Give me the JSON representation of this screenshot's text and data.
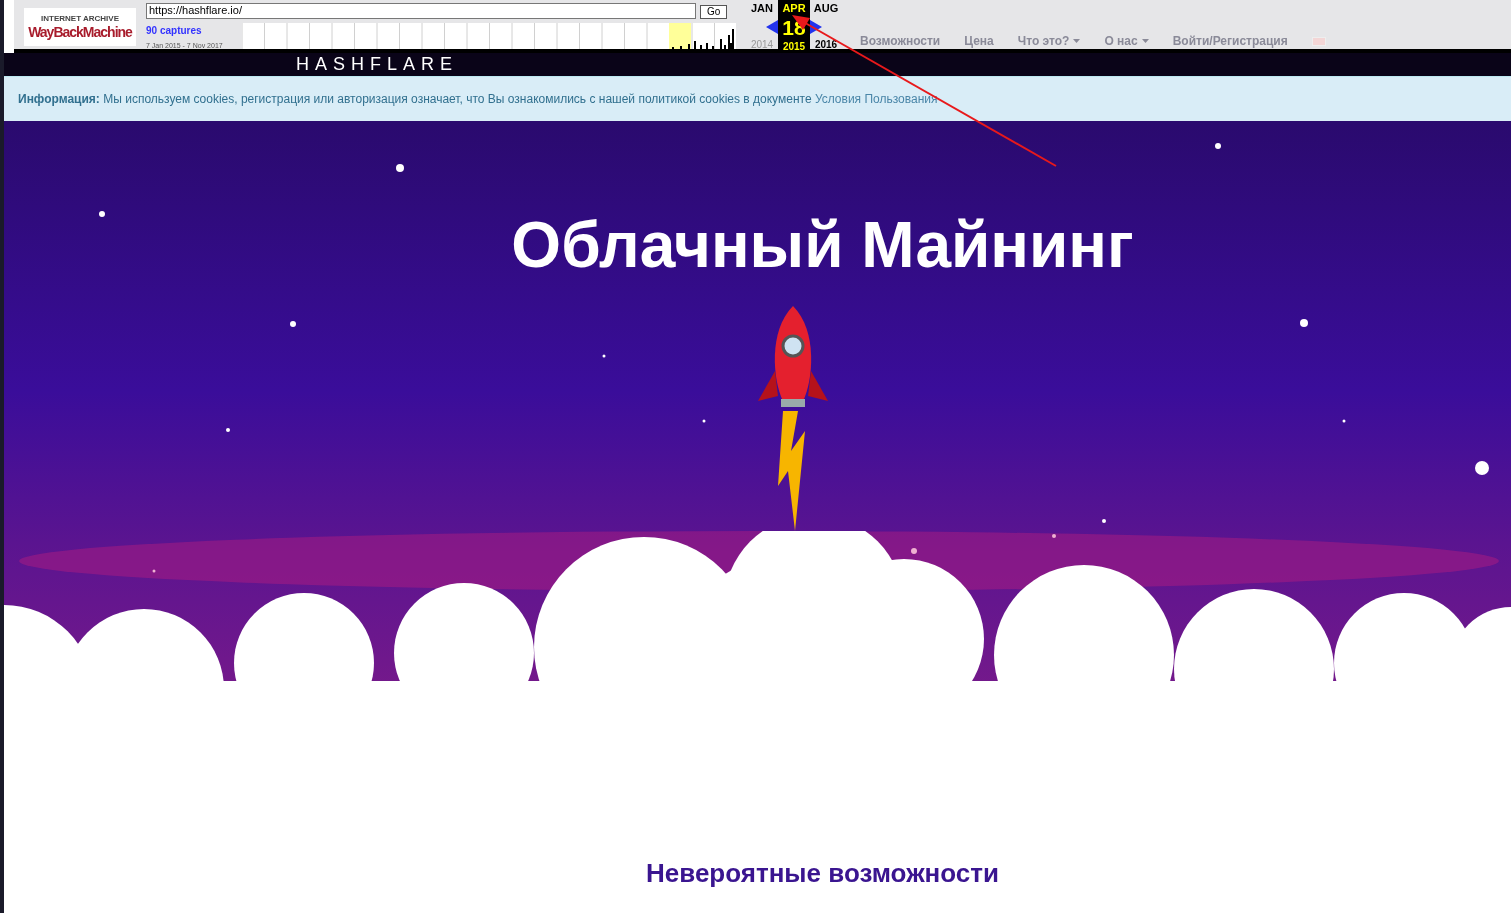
{
  "wayback": {
    "logo_top": "INTERNET ARCHIVE",
    "logo_main": "WayBackMachine",
    "url": "https://hashflare.io/",
    "go_button": "Go",
    "captures": "90 captures",
    "range": "7 Jan 2015 - 7 Nov 2017",
    "months": [
      {
        "label": "JAN",
        "selected": false
      },
      {
        "label": "APR",
        "selected": true
      },
      {
        "label": "AUG",
        "selected": false
      }
    ],
    "day": "18",
    "years": [
      {
        "label": "2014",
        "selected": false
      },
      {
        "label": "2015",
        "selected": true
      },
      {
        "label": "2016",
        "selected": false
      }
    ]
  },
  "site_logo": "HASHFLARE",
  "nav": [
    {
      "label": "Возможности",
      "dropdown": false
    },
    {
      "label": "Цена",
      "dropdown": false
    },
    {
      "label": "Что это?",
      "dropdown": true
    },
    {
      "label": "О нас",
      "dropdown": true
    },
    {
      "label": "Войти/Регистрация",
      "dropdown": false
    }
  ],
  "info": {
    "label": "Информация:",
    "text": "Мы используем cookies, регистрация или авторизация означает, что Вы ознакомились с нашей политикой cookies в документе",
    "link": "Условия Пользования"
  },
  "hero": {
    "title": "Облачный Майнинг"
  },
  "section_title": "Невероятные возможности"
}
